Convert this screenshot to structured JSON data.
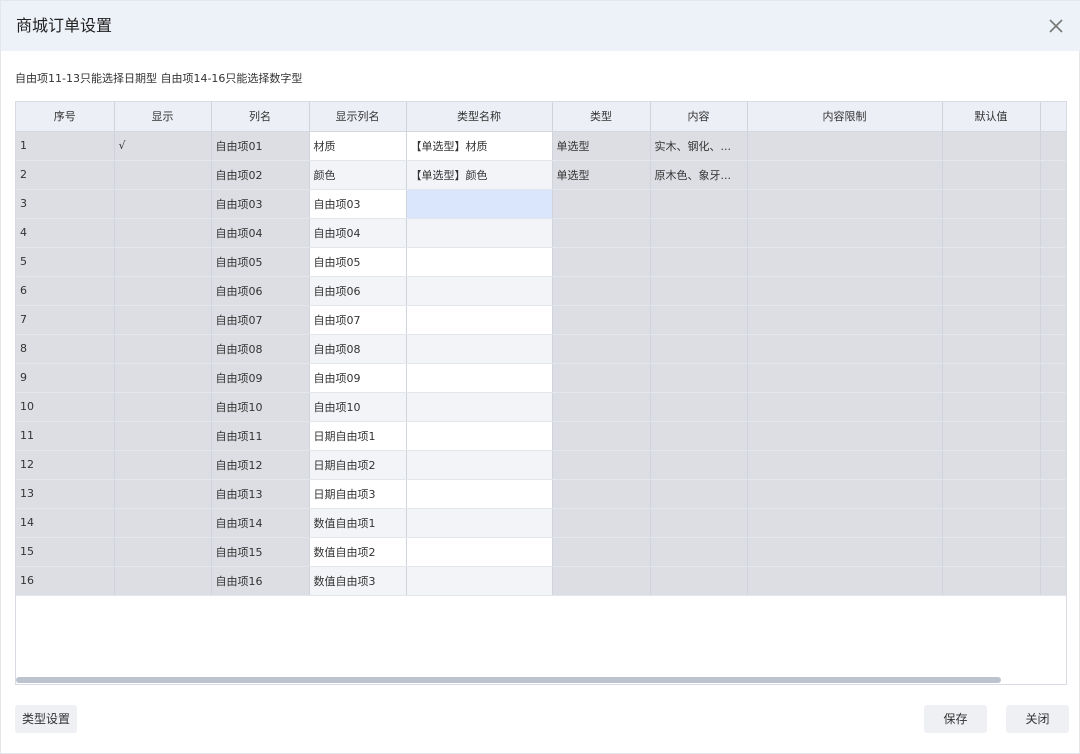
{
  "dialog": {
    "title": "商城订单设置",
    "close_icon": "close-icon"
  },
  "note": "自由项11-13只能选择日期型 自由项14-16只能选择数字型",
  "table": {
    "headers": [
      "序号",
      "显示",
      "列名",
      "显示列名",
      "类型名称",
      "类型",
      "内容",
      "内容限制",
      "默认值",
      ""
    ],
    "rows": [
      [
        "1",
        "√",
        "自由项01",
        "材质",
        "【单选型】材质",
        "单选型",
        "实木、钢化、...",
        "",
        "",
        ""
      ],
      [
        "2",
        "",
        "自由项02",
        "颜色",
        "【单选型】颜色",
        "单选型",
        "原木色、象牙...",
        "",
        "",
        ""
      ],
      [
        "3",
        "",
        "自由项03",
        "自由项03",
        "",
        "",
        "",
        "",
        "",
        ""
      ],
      [
        "4",
        "",
        "自由项04",
        "自由项04",
        "",
        "",
        "",
        "",
        "",
        ""
      ],
      [
        "5",
        "",
        "自由项05",
        "自由项05",
        "",
        "",
        "",
        "",
        "",
        ""
      ],
      [
        "6",
        "",
        "自由项06",
        "自由项06",
        "",
        "",
        "",
        "",
        "",
        ""
      ],
      [
        "7",
        "",
        "自由项07",
        "自由项07",
        "",
        "",
        "",
        "",
        "",
        ""
      ],
      [
        "8",
        "",
        "自由项08",
        "自由项08",
        "",
        "",
        "",
        "",
        "",
        ""
      ],
      [
        "9",
        "",
        "自由项09",
        "自由项09",
        "",
        "",
        "",
        "",
        "",
        ""
      ],
      [
        "10",
        "",
        "自由项10",
        "自由项10",
        "",
        "",
        "",
        "",
        "",
        ""
      ],
      [
        "11",
        "",
        "自由项11",
        "日期自由项1",
        "",
        "",
        "",
        "",
        "",
        ""
      ],
      [
        "12",
        "",
        "自由项12",
        "日期自由项2",
        "",
        "",
        "",
        "",
        "",
        ""
      ],
      [
        "13",
        "",
        "自由项13",
        "日期自由项3",
        "",
        "",
        "",
        "",
        "",
        ""
      ],
      [
        "14",
        "",
        "自由项14",
        "数值自由项1",
        "",
        "",
        "",
        "",
        "",
        ""
      ],
      [
        "15",
        "",
        "自由项15",
        "数值自由项2",
        "",
        "",
        "",
        "",
        "",
        ""
      ],
      [
        "16",
        "",
        "自由项16",
        "数值自由项3",
        "",
        "",
        "",
        "",
        "",
        ""
      ]
    ]
  },
  "footer": {
    "type_settings_label": "类型设置",
    "save_label": "保存",
    "close_label": "关闭"
  }
}
